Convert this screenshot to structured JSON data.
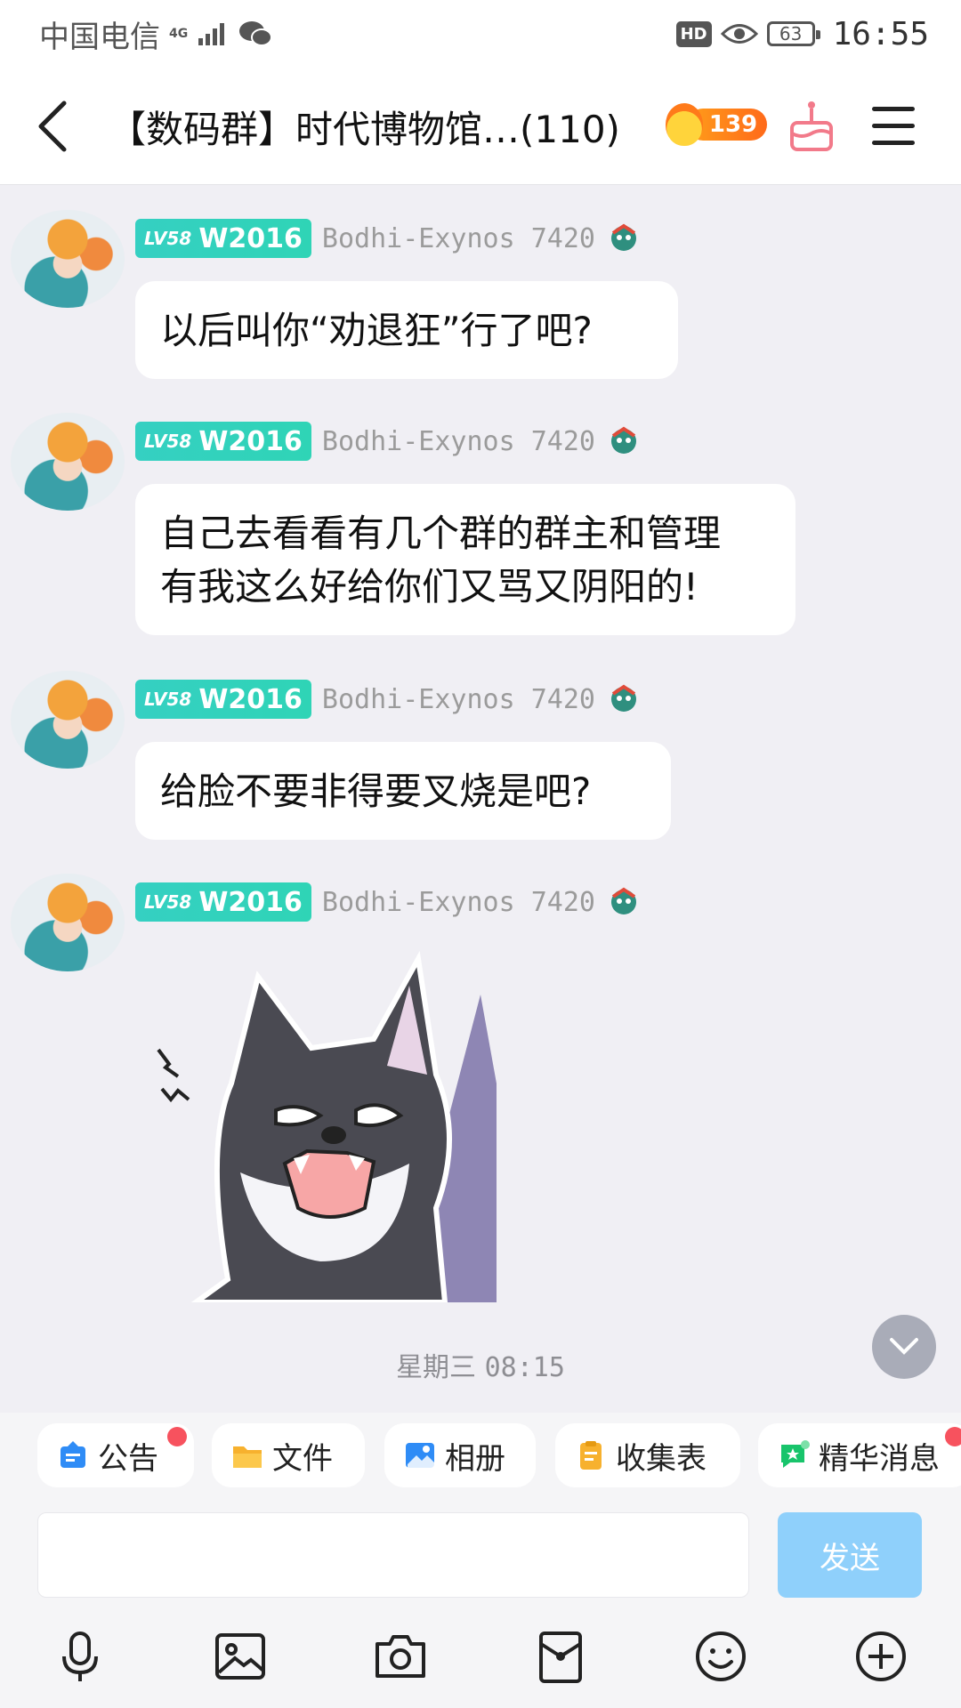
{
  "status_bar": {
    "carrier": "中国电信",
    "network": "4G",
    "hd": "HD",
    "battery": "63",
    "time": "16:55"
  },
  "header": {
    "title": "【数码群】时代博物馆…(110)",
    "fire_count": "139",
    "colors": {
      "fire": "#ff7a1a",
      "cake": "#f7525e"
    }
  },
  "messages": [
    {
      "level": "LV58",
      "title_badge": "W2016",
      "nickname": "Bodhi-Exynos 7420",
      "text": "以后叫你“劝退狂”行了吧?"
    },
    {
      "level": "LV58",
      "title_badge": "W2016",
      "nickname": "Bodhi-Exynos 7420",
      "text_lines": [
        "自己去看看有几个群的群主和管理",
        "有我这么好给你们又骂又阴阳的!"
      ]
    },
    {
      "level": "LV58",
      "title_badge": "W2016",
      "nickname": "Bodhi-Exynos 7420",
      "text": "给脸不要非得要叉烧是吧?"
    },
    {
      "level": "LV58",
      "title_badge": "W2016",
      "nickname": "Bodhi-Exynos 7420",
      "sticker": "angry-wolf-sticker"
    }
  ],
  "timestamp": {
    "day": "星期三",
    "time": "08:15"
  },
  "quick_actions": [
    {
      "label": "公告",
      "icon": "announcement-icon",
      "dot": true
    },
    {
      "label": "文件",
      "icon": "folder-icon",
      "dot": false
    },
    {
      "label": "相册",
      "icon": "album-icon",
      "dot": false
    },
    {
      "label": "收集表",
      "icon": "form-icon",
      "dot": false
    },
    {
      "label": "精华消息",
      "icon": "essence-icon",
      "dot": true
    }
  ],
  "input": {
    "value": "",
    "send_label": "发送"
  },
  "toolbar": [
    "mic-icon",
    "image-icon",
    "camera-icon",
    "red-packet-icon",
    "emoji-icon",
    "plus-icon"
  ]
}
